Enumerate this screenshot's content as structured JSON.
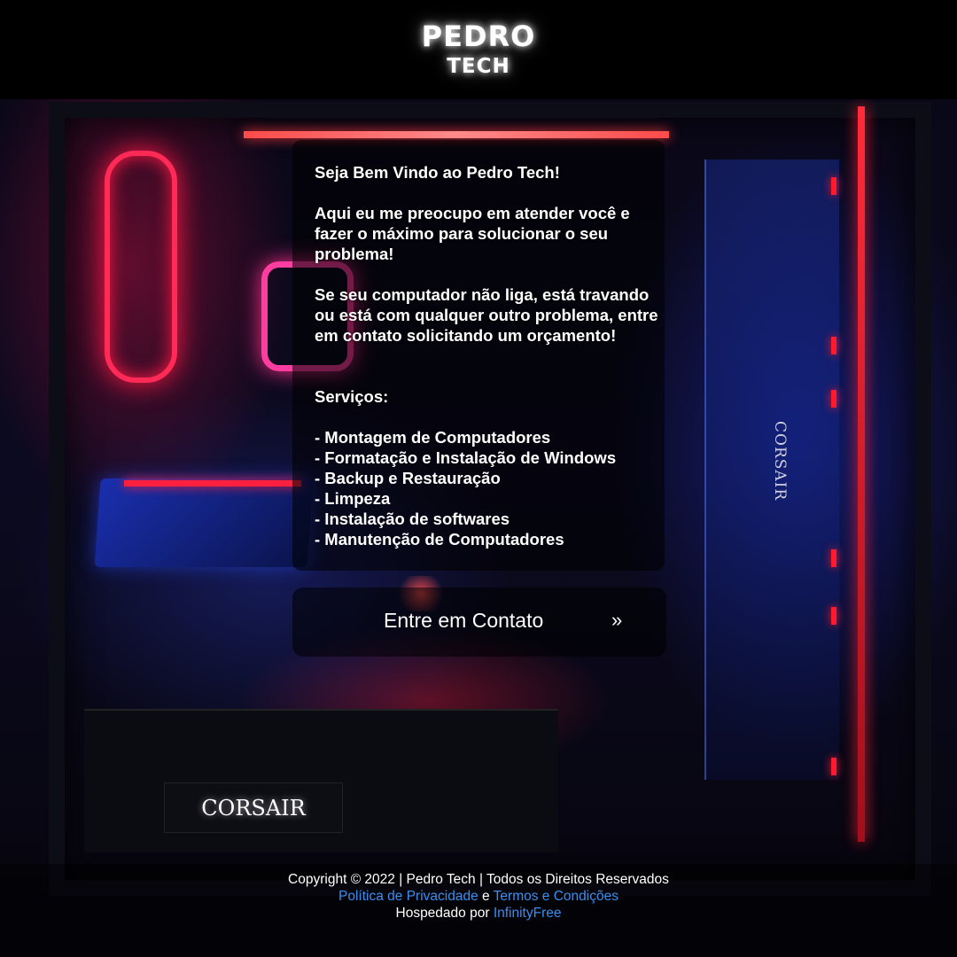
{
  "header": {
    "brand_top": "PEDRO",
    "brand_bottom": "TECH"
  },
  "background": {
    "vertical_brand": "CORSAIR",
    "psu_brand": "CORSAIR"
  },
  "card": {
    "welcome": "Seja Bem Vindo ao Pedro Tech!",
    "intro": "Aqui eu me preocupo em atender você e fazer o máximo para solucionar o seu problema!",
    "problem": "Se seu computador não liga, está travando ou está com qualquer outro problema, entre em contato solicitando um orçamento!",
    "services_title": "Serviços:",
    "services": [
      "- Montagem de Computadores",
      "- Formatação e Instalação de Windows",
      "- Backup e Restauração",
      "- Limpeza",
      "- Instalação de softwares",
      "- Manutenção de Computadores"
    ]
  },
  "cta": {
    "label": "Entre em Contato",
    "arrow": "»"
  },
  "footer": {
    "copyright": "Copyright © 2022 | Pedro Tech | Todos os Direitos Reservados",
    "privacy_link": "Política de Privacidade",
    "and": "e",
    "terms_link": "Termos e Condições",
    "hosted_by": "Hospedado por",
    "host_link": "InfinityFree"
  },
  "colors": {
    "link": "#3a8ef0",
    "background": "#07050f",
    "accent_red": "#ff2a55",
    "accent_blue": "#1a2fb0"
  }
}
